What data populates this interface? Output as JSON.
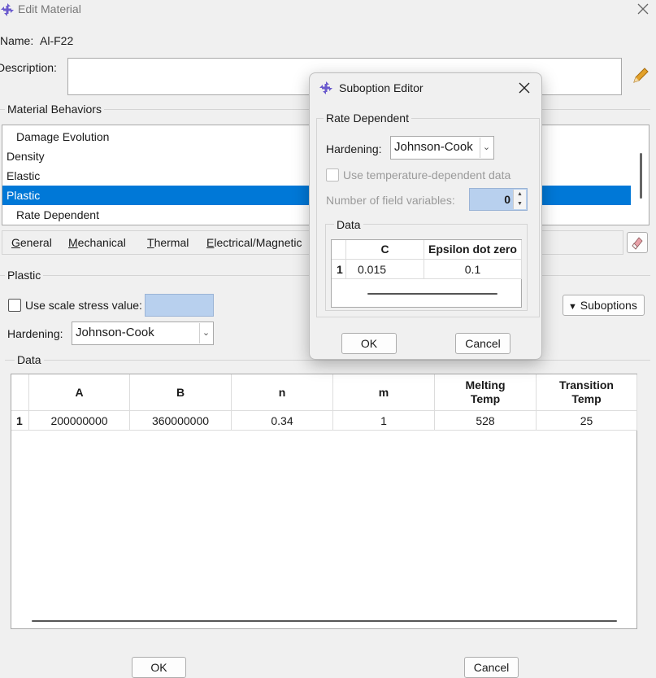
{
  "window": {
    "title": "Edit Material"
  },
  "name": {
    "label": "Name:",
    "value": "Al-F22"
  },
  "description": {
    "label": "Description:",
    "value": ""
  },
  "behaviors": {
    "group_label": "Material Behaviors",
    "items": [
      {
        "label": "Damage Evolution",
        "indent": true,
        "selected": false
      },
      {
        "label": "Density",
        "indent": false,
        "selected": false
      },
      {
        "label": "Elastic",
        "indent": false,
        "selected": false
      },
      {
        "label": "Plastic",
        "indent": false,
        "selected": true
      },
      {
        "label": "Rate Dependent",
        "indent": true,
        "selected": false
      }
    ]
  },
  "menus": [
    {
      "first": "G",
      "rest": "eneral"
    },
    {
      "first": "M",
      "rest": "echanical"
    },
    {
      "first": "T",
      "rest": "hermal"
    },
    {
      "first": "E",
      "rest": "lectrical/Magnetic"
    }
  ],
  "plastic": {
    "group_label": "Plastic",
    "scale_stress_label": "Use scale stress value:",
    "hardening_label": "Hardening:",
    "hardening_value": "Johnson-Cook",
    "suboptions_label": "Suboptions"
  },
  "data_table": {
    "group_label": "Data",
    "headers": [
      "A",
      "B",
      "n",
      "m",
      "Melting Temp",
      "Transition Temp"
    ],
    "rows": [
      {
        "num": "1",
        "cells": [
          "200000000",
          "360000000",
          "0.34",
          "1",
          "528",
          "25"
        ]
      }
    ]
  },
  "buttons": {
    "ok": "OK",
    "cancel": "Cancel"
  },
  "suboption_editor": {
    "title": "Suboption Editor",
    "group_label": "Rate Dependent",
    "hardening_label": "Hardening:",
    "hardening_value": "Johnson-Cook",
    "temp_dependent_label": "Use temperature-dependent data",
    "field_variables_label": "Number of field variables:",
    "field_variables_value": "0",
    "data_label": "Data",
    "headers": [
      "C",
      "Epsilon dot zero"
    ],
    "rows": [
      {
        "num": "1",
        "cells": [
          "0.015",
          "0.1"
        ]
      }
    ],
    "ok": "OK",
    "cancel": "Cancel"
  },
  "colors": {
    "selection": "#0078d7",
    "field_highlight": "#b8d0ee",
    "icon": "#6a5acd"
  },
  "icons": [
    "app-icon",
    "close-icon",
    "pencil-icon",
    "eraser-icon",
    "dropdown-arrow-icon",
    "triangle-down-icon",
    "spinner-icon"
  ]
}
